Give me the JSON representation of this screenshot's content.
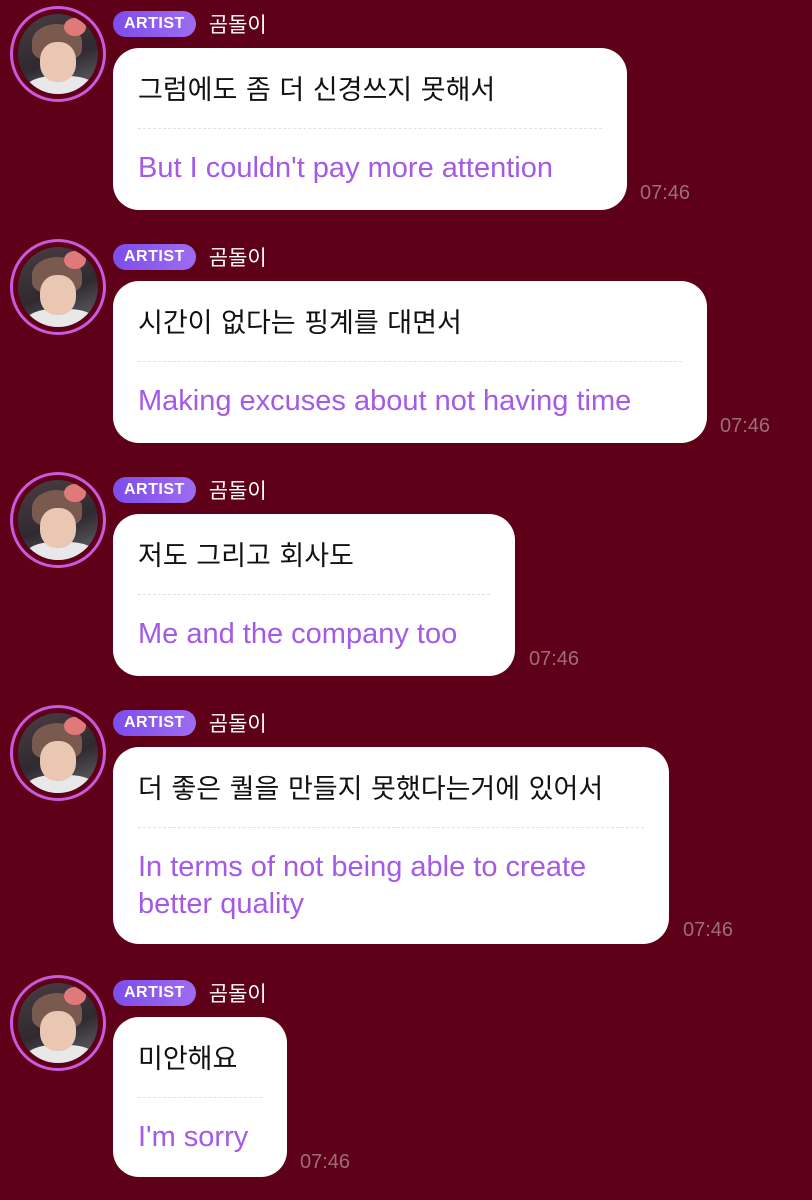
{
  "messages": [
    {
      "badge": "ARTIST",
      "sender": "곰돌이",
      "korean": "그럼에도 좀 더 신경쓰지 못해서",
      "english": "But I couldn't pay more attention",
      "time": "07:46"
    },
    {
      "badge": "ARTIST",
      "sender": "곰돌이",
      "korean": "시간이 없다는 핑계를 대면서",
      "english": "Making excuses about not having time",
      "time": "07:46"
    },
    {
      "badge": "ARTIST",
      "sender": "곰돌이",
      "korean": "저도 그리고 회사도",
      "english": "Me and the company too",
      "time": "07:46"
    },
    {
      "badge": "ARTIST",
      "sender": "곰돌이",
      "korean": "더 좋은 퀄을 만들지 못했다는거에 있어서",
      "english": "In terms of not being able to create\nbetter quality",
      "time": "07:46"
    },
    {
      "badge": "ARTIST",
      "sender": "곰돌이",
      "korean": "미안해요",
      "english": "I'm sorry",
      "time": "07:46"
    }
  ],
  "colors": {
    "background": "#5e0018",
    "bubble": "#ffffff",
    "translation_text": "#a45ae6",
    "badge": "#8a5cf0",
    "avatar_ring": "#c75bdc",
    "timestamp": "#9d6c79"
  },
  "icons": {
    "avatar": "avatar-photo",
    "badge": "artist-badge"
  }
}
